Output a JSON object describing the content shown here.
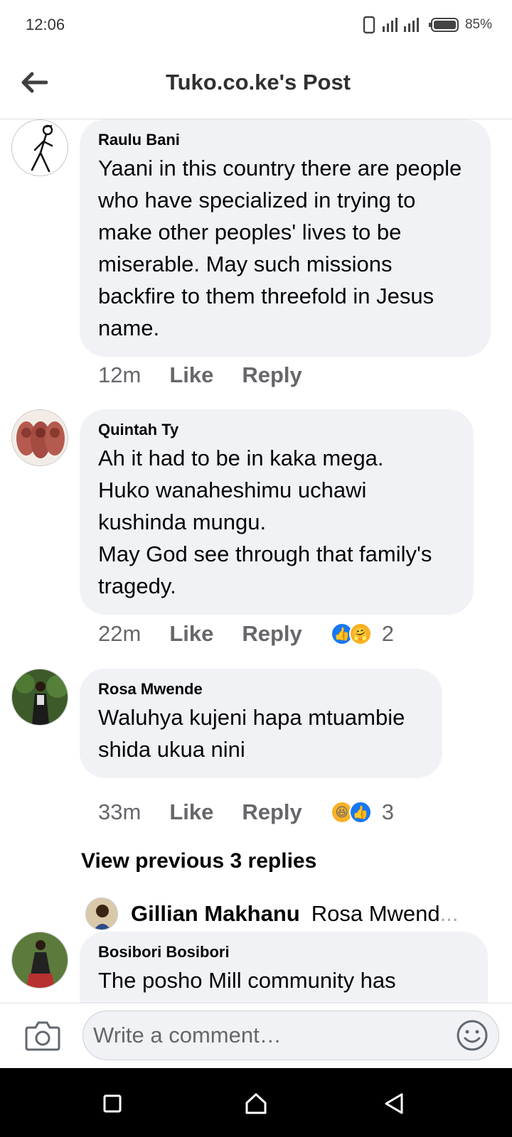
{
  "status": {
    "time": "12:06",
    "battery": "85%"
  },
  "header": {
    "title": "Tuko.co.ke's Post"
  },
  "comments": [
    {
      "author": "Raulu Bani",
      "text": "Yaani in this country there are people who have specialized in trying to make other peoples' lives to be miserable. May such missions backfire to them threefold in Jesus name.",
      "time": "12m",
      "like_label": "Like",
      "reply_label": "Reply"
    },
    {
      "author": "Quintah Ty",
      "text": "Ah it had to be in kaka mega.\nHuko wanaheshimu uchawi kushinda mungu.\nMay God see through that family's tragedy.",
      "time": "22m",
      "like_label": "Like",
      "reply_label": "Reply",
      "reactions": [
        "like",
        "care"
      ],
      "reaction_count": "2"
    },
    {
      "author": "Rosa Mwende",
      "text": "Waluhya kujeni hapa mtuambie shida ukua nini",
      "time": "33m",
      "like_label": "Like",
      "reply_label": "Reply",
      "reactions": [
        "haha",
        "like"
      ],
      "reaction_count": "3",
      "view_replies": "View previous 3 replies",
      "reply_preview": {
        "author": "Gillian Makhanu",
        "text": "Rosa Mwend",
        "ellipsis": "..."
      }
    },
    {
      "author": "Bosibori Bosibori",
      "text": "The posho Mill community has"
    }
  ],
  "composer": {
    "placeholder": "Write a comment…"
  }
}
